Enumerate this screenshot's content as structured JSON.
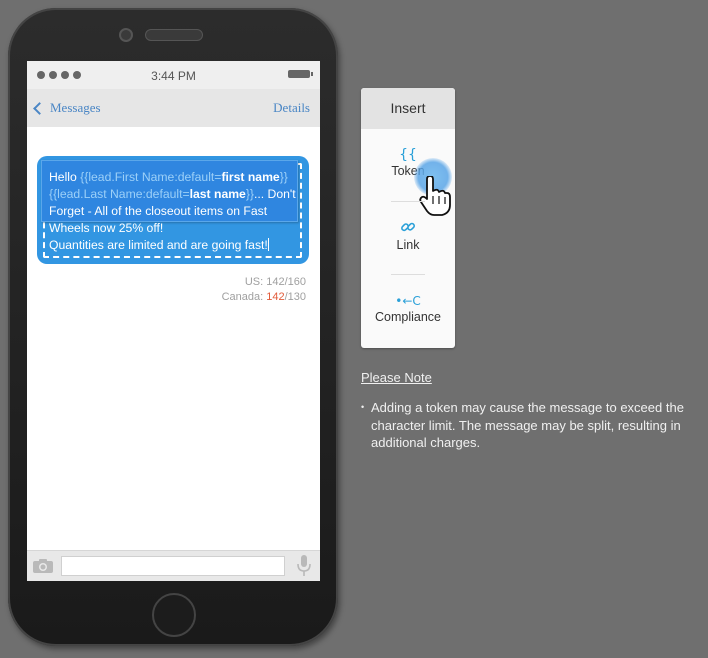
{
  "phone": {
    "status_time": "3:44 PM",
    "nav": {
      "back_label": "Messages",
      "details_label": "Details"
    },
    "message": {
      "hello": "Hello ",
      "token_first_prefix": "{{lead.First Name:default=",
      "token_first_default": "first name",
      "token_suffix": "}}",
      "token_last_prefix": "{{lead.Last Name:default=",
      "token_last_default": "last name",
      "after_token": "... Don't Forget - All of the closeout items on Fast Wheels now 25% off!",
      "line2": "Quantities are limited and are going fast!"
    },
    "counts": {
      "us_label": "US: ",
      "us_used": "142",
      "us_limit": "/160",
      "canada_label": "Canada: ",
      "canada_used": "142",
      "canada_limit": "/130"
    }
  },
  "insert_panel": {
    "title": "Insert",
    "items": [
      {
        "label": "Token",
        "icon": "{{",
        "icon_name": "curly-braces-icon"
      },
      {
        "label": "Link",
        "icon": "🔗",
        "icon_name": "link-icon"
      },
      {
        "label": "Compliance",
        "icon": "•←C",
        "icon_name": "compliance-icon"
      }
    ]
  },
  "note": {
    "title": "Please Note",
    "text": "Adding a token may cause the message to exceed the character limit. The message may be split, resulting in additional charges."
  },
  "colors": {
    "accent": "#3296e2",
    "over_limit": "#e25b3a",
    "icon_blue": "#2aa0d8"
  }
}
